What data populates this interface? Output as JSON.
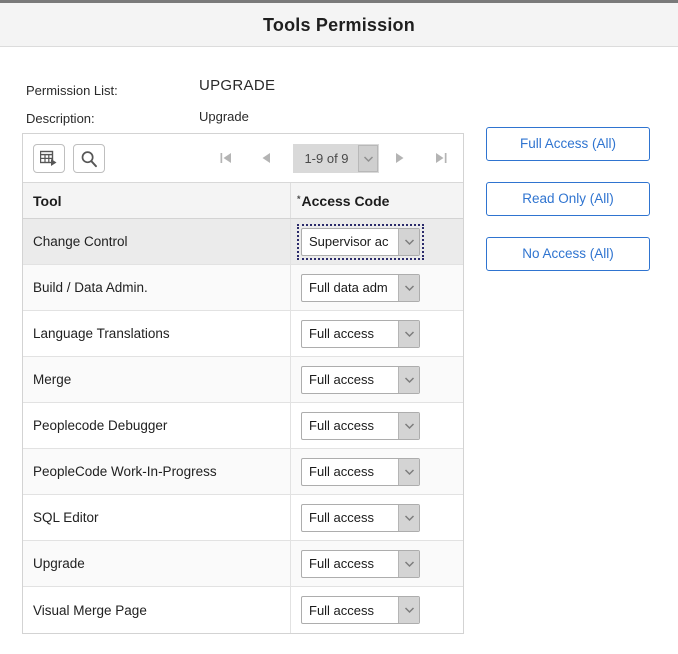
{
  "header": {
    "title": "Tools Permission"
  },
  "fields": {
    "permission_list_label": "Permission List:",
    "permission_list_value": "UPGRADE",
    "description_label": "Description:",
    "description_value": "Upgrade"
  },
  "grid": {
    "toolbar": {
      "grid_view_icon": "grid-export-icon",
      "find_icon": "search-icon"
    },
    "pager": {
      "first_icon": "first-page-icon",
      "prev_icon": "previous-page-icon",
      "range_label": "1-9 of 9",
      "dropdown_icon": "chevron-down-icon",
      "next_icon": "next-page-icon",
      "last_icon": "last-page-icon"
    },
    "columns": {
      "tool": "Tool",
      "access_code": "Access Code",
      "access_code_required_marker": "*"
    },
    "rows": [
      {
        "tool": "Change Control",
        "access": "Supervisor ac",
        "selected": true
      },
      {
        "tool": "Build / Data Admin.",
        "access": "Full data adm",
        "selected": false
      },
      {
        "tool": "Language Translations",
        "access": "Full access",
        "selected": false
      },
      {
        "tool": "Merge",
        "access": "Full access",
        "selected": false
      },
      {
        "tool": "Peoplecode Debugger",
        "access": "Full access",
        "selected": false
      },
      {
        "tool": "PeopleCode Work-In-Progress",
        "access": "Full access",
        "selected": false
      },
      {
        "tool": "SQL Editor",
        "access": "Full access",
        "selected": false
      },
      {
        "tool": "Upgrade",
        "access": "Full access",
        "selected": false
      },
      {
        "tool": "Visual Merge Page",
        "access": "Full access",
        "selected": false
      }
    ]
  },
  "side_buttons": [
    {
      "label": "Full Access (All)"
    },
    {
      "label": "Read Only (All)"
    },
    {
      "label": "No Access (All)"
    }
  ],
  "colors": {
    "accent_blue": "#2f74d0",
    "header_bg": "#f4f4f4",
    "selected_row_bg": "#ebebeb"
  }
}
